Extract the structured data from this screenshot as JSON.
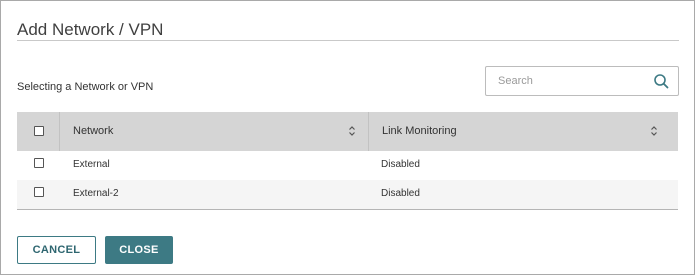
{
  "dialog": {
    "title": "Add Network / VPN",
    "subtitle": "Selecting a Network or VPN"
  },
  "search": {
    "placeholder": "Search",
    "value": ""
  },
  "table": {
    "columns": [
      "Network",
      "Link Monitoring"
    ],
    "rows": [
      {
        "network": "External",
        "link_monitoring": "Disabled"
      },
      {
        "network": "External-2",
        "link_monitoring": "Disabled"
      }
    ]
  },
  "buttons": {
    "cancel": "CANCEL",
    "close": "CLOSE"
  },
  "colors": {
    "accent": "#3d7a84",
    "header_bg": "#d5d5d5"
  }
}
